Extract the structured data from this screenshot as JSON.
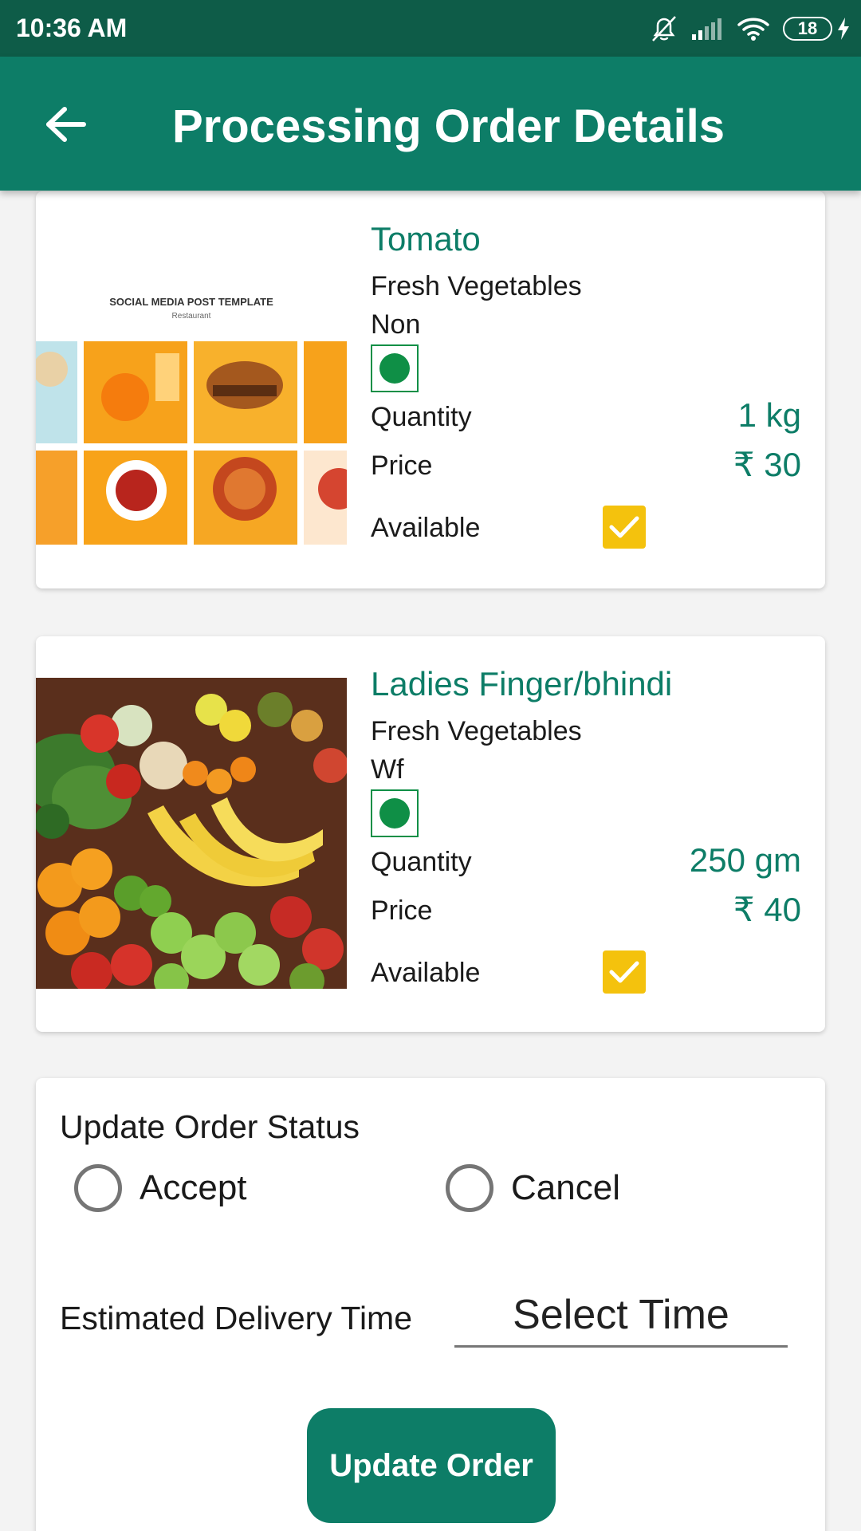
{
  "status_bar": {
    "time": "10:36 AM",
    "battery": "18"
  },
  "app_bar": {
    "title": "Processing Order Details"
  },
  "items": [
    {
      "name": "Tomato",
      "category": "Fresh Vegetables",
      "sub_label": "Non",
      "quantity_label": "Quantity",
      "quantity": "1 kg",
      "price_label": "Price",
      "price": "₹ 30",
      "available_label": "Available",
      "available": true,
      "image": "social-media-post-template-restaurant",
      "image_caption": "SOCIAL MEDIA POST TEMPLATE",
      "image_subcaption": "Restaurant"
    },
    {
      "name": "Ladies Finger/bhindi",
      "category": "Fresh Vegetables",
      "sub_label": "Wf",
      "quantity_label": "Quantity",
      "quantity": "250 gm",
      "price_label": "Price",
      "price": "₹ 40",
      "available_label": "Available",
      "available": true,
      "image": "fruit-market-display"
    }
  ],
  "order_status": {
    "title": "Update Order Status",
    "options": [
      "Accept",
      "Cancel"
    ],
    "eta_label": "Estimated Delivery Time",
    "time_placeholder": "Select Time",
    "submit_label": "Update Order"
  },
  "colors": {
    "primary": "#0d7d67",
    "status_bar": "#0e5c48",
    "accent": "#f4c20d",
    "veg": "#0f8f46"
  }
}
